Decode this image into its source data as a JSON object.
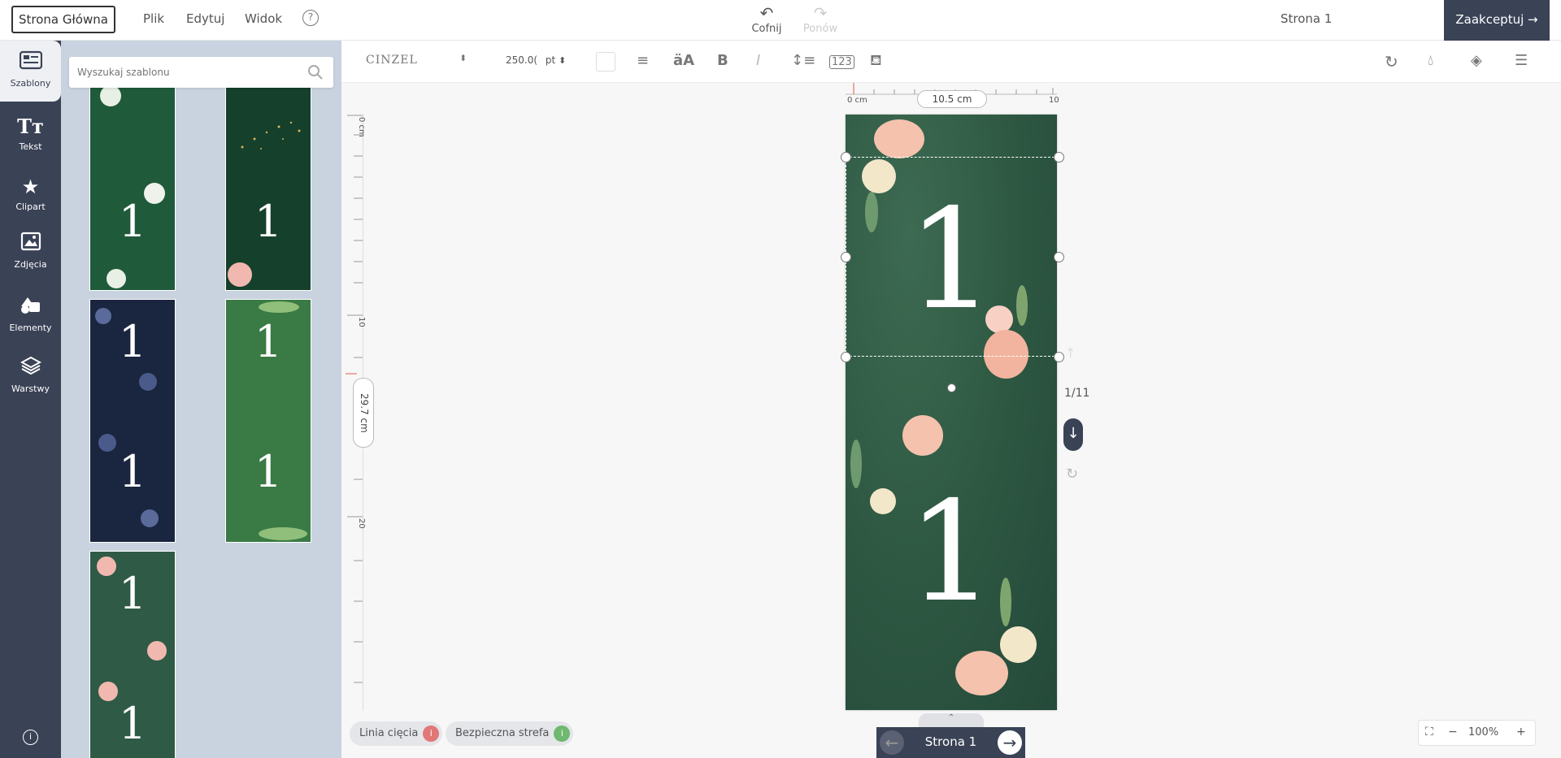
{
  "topbar": {
    "home_label": "Strona Główna",
    "menu": [
      "Plik",
      "Edytuj",
      "Widok"
    ],
    "help_icon": "?",
    "undo_label": "Cofnij",
    "redo_label": "Ponów",
    "page_name": "Strona 1",
    "accept_label": "Zaakceptuj"
  },
  "leftnav": {
    "items": [
      {
        "label": "Szablony",
        "icon": "templates-icon"
      },
      {
        "label": "Tekst",
        "icon": "text-icon"
      },
      {
        "label": "Clipart",
        "icon": "star-icon"
      },
      {
        "label": "Zdjęcia",
        "icon": "photo-icon"
      },
      {
        "label": "Elementy",
        "icon": "shapes-icon"
      },
      {
        "label": "Warstwy",
        "icon": "layers-icon"
      }
    ]
  },
  "panel": {
    "search_placeholder": "Wyszukaj szablonu",
    "templates": [
      {
        "number": "1",
        "bg": "#1f5a3b",
        "style": "floral-green"
      },
      {
        "number": "1",
        "bg": "#15402b",
        "style": "gold-dots"
      },
      {
        "number": "1",
        "bg": "#1a2540",
        "style": "navy-floral"
      },
      {
        "number": "1",
        "bg": "#3a7a45",
        "style": "green-leaves"
      },
      {
        "number": "1",
        "bg": "#2f5a46",
        "style": "floral-soft"
      }
    ]
  },
  "toolbar": {
    "font_name": "Cinzel",
    "font_size": "250.0(",
    "font_unit": "pt"
  },
  "canvas": {
    "ruler_h_start": "0 cm",
    "ruler_h_width": "10.5 cm",
    "ruler_h_end": "10",
    "ruler_v_start": "0 cm",
    "ruler_v_10": "10",
    "ruler_v_20": "20",
    "ruler_v_height": "29.7 cm",
    "page_top_number": "1",
    "page_bottom_number": "1",
    "page_counter": "1/11"
  },
  "bottom": {
    "cut_line_label": "Linia cięcia",
    "safe_zone_label": "Bezpieczna strefa",
    "page_label": "Strona 1",
    "zoom": "100%"
  },
  "colors": {
    "accent": "#3a4256",
    "page_bg": "#2e5842",
    "panel_bg": "#c9d3e0"
  }
}
